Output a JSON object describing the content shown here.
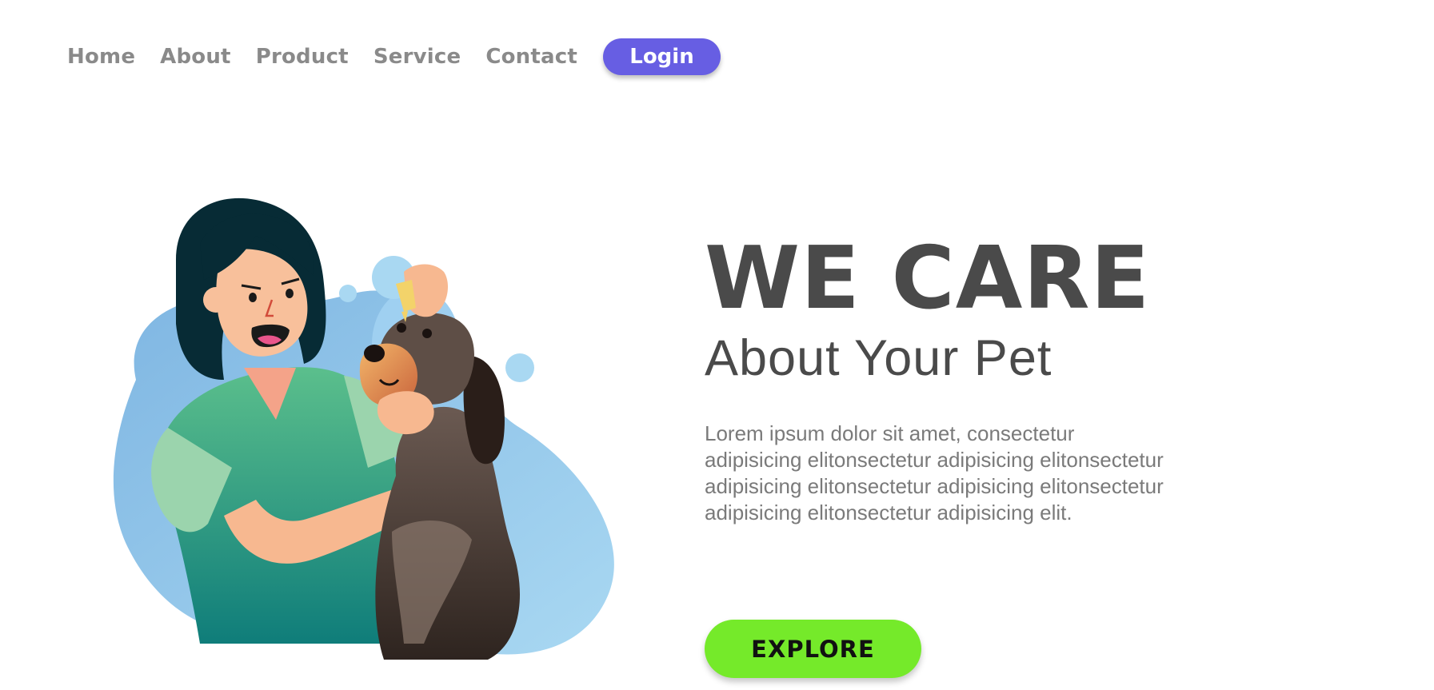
{
  "nav": {
    "items": [
      {
        "label": "Home"
      },
      {
        "label": "About"
      },
      {
        "label": "Product"
      },
      {
        "label": "Service"
      },
      {
        "label": "Contact"
      }
    ],
    "login_label": "Login"
  },
  "hero": {
    "title": "WE CARE",
    "subtitle": "About Your Pet",
    "description": "Lorem ipsum dolor sit amet, consectetur adipisicing elitonsectetur adipisicing elitonsectetur adipisicing elitonsectetur adipisicing elitonsectetur adipisicing elitonsectetur adipisicing elit.",
    "explore_label": "EXPLORE"
  },
  "colors": {
    "accent_login": "#675ee3",
    "accent_explore": "#75ea2a",
    "heading": "#4a4a4a",
    "nav_text": "#8a8a8a"
  },
  "illustration": {
    "subject": "woman-with-dog-illustration"
  }
}
